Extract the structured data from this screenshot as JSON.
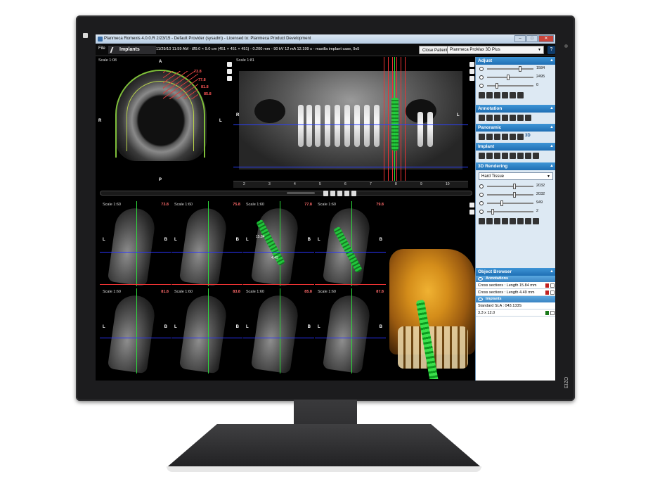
{
  "window": {
    "title": "Planmeca Romexis 4.0.0.R 2/23/15 - Default Provider (sysadm) - Licensed to: Planmeca Product Development"
  },
  "menubar": {
    "file_label": "File",
    "module_tab": "Implants",
    "patient_info": "11/29/10 11:59 AM - Ø9.0 × 9.0 cm (451 × 451 × 451) - 0.200 mm - 90 kV 12 mA 12.199 s - maxilla implant case, 9x5",
    "close_patient_label": "Close Patient",
    "device_selected": "Planmeca ProMax 3D Plus",
    "help_label": "?"
  },
  "axial_view": {
    "scale": "Scale 1:08",
    "orient_top": "A",
    "orient_left": "R",
    "orient_right": "L",
    "orient_bottom": "P",
    "labels": [
      "73.8",
      "77.8",
      "81.8",
      "85.8"
    ]
  },
  "pano_view": {
    "scale": "Scale 1:81",
    "orient_left": "R",
    "orient_right": "L",
    "ruler_ticks": [
      "2",
      "3",
      "4",
      "5",
      "6",
      "7",
      "8",
      "9",
      "10"
    ],
    "ruler_center": "-o-"
  },
  "cross_sections": [
    {
      "scale": "Scale 1:60",
      "num": "73.8"
    },
    {
      "scale": "Scale 1:60",
      "num": "75.8"
    },
    {
      "scale": "Scale 1:60",
      "num": "77.8",
      "meas1": "15.84",
      "meas2": "4.49"
    },
    {
      "scale": "Scale 1:60",
      "num": "79.8"
    },
    {
      "scale": "Scale 1:60",
      "num": "81.8"
    },
    {
      "scale": "Scale 1:60",
      "num": "83.8"
    },
    {
      "scale": "Scale 1:60",
      "num": "85.8"
    },
    {
      "scale": "Scale 1:60",
      "num": "87.8"
    }
  ],
  "cross_orient": {
    "left": "L",
    "right": "B"
  },
  "panel": {
    "adjust": {
      "title": "Adjust",
      "values": [
        "1584",
        "2495",
        "0"
      ],
      "levels": [
        0.72,
        0.45,
        0.2
      ]
    },
    "annotation": {
      "title": "Annotation"
    },
    "panoramic": {
      "title": "Panoramic",
      "mode_3d": "3D"
    },
    "implant": {
      "title": "Implant"
    },
    "rendering": {
      "title": "3D Rendering",
      "preset": "Hard Tissue",
      "values": [
        "2032",
        "2032",
        "949",
        "2"
      ],
      "levels": [
        0.6,
        0.6,
        0.3,
        0.1
      ]
    },
    "object_browser": {
      "title": "Object Browser",
      "annotations_header": "Annotations",
      "annotations": [
        "Cross sections : Length 15.84 mm",
        "Cross sections : Length 4.49 mm"
      ],
      "implants_header": "Implants",
      "implants": [
        "Standard SLA : 043.133S",
        "3.3 x 12.0"
      ]
    }
  },
  "monitor": {
    "brand": "EIZO"
  }
}
